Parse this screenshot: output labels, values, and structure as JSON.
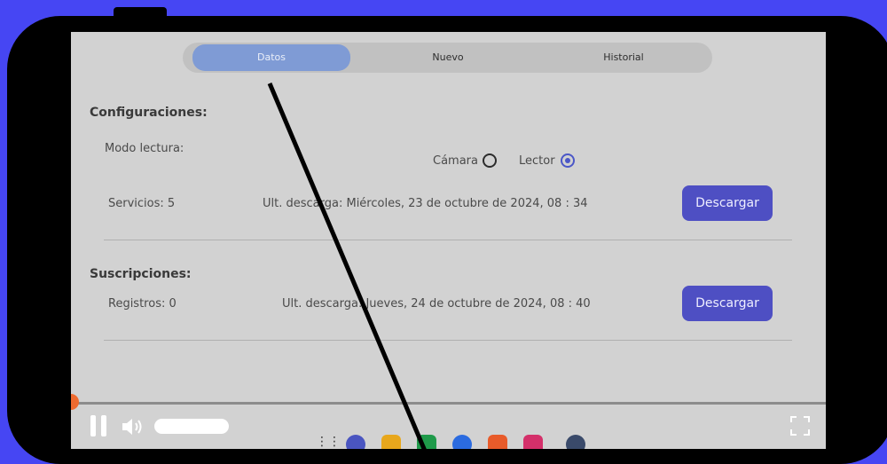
{
  "tabs": [
    {
      "label": "Datos",
      "active": true
    },
    {
      "label": "Nuevo",
      "active": false
    },
    {
      "label": "Historial",
      "active": false
    }
  ],
  "config": {
    "title": "Configuraciones:",
    "modo_label": "Modo lectura:",
    "options": [
      {
        "label": "Cámara",
        "selected": false
      },
      {
        "label": "Lector",
        "selected": true
      }
    ],
    "servicios": "Servicios: 5",
    "ult_descarga": "Ult. descarga:  Miércoles, 23 de octubre de 2024,  08 : 34",
    "button": "Descargar"
  },
  "subs": {
    "title": "Suscripciones:",
    "registros": "Registros: 0",
    "ult_descarga": "Ult. descarga: Jueves, 24 de octubre de 2024,  08 : 40",
    "button": "Descargar"
  },
  "player": {
    "progress": 0,
    "accent": "#ef6a2f"
  },
  "colors": {
    "background": "#4646f3",
    "active_tab": "#7f9bd5",
    "primary_button": "#4e4fc3",
    "radio_selected": "#4b57c7"
  },
  "navbar_icons": [
    "apps-grid-icon",
    "chat-icon",
    "files-icon",
    "phone-icon",
    "browser-icon",
    "contacts-icon",
    "gallery-icon",
    "settings-icon"
  ]
}
